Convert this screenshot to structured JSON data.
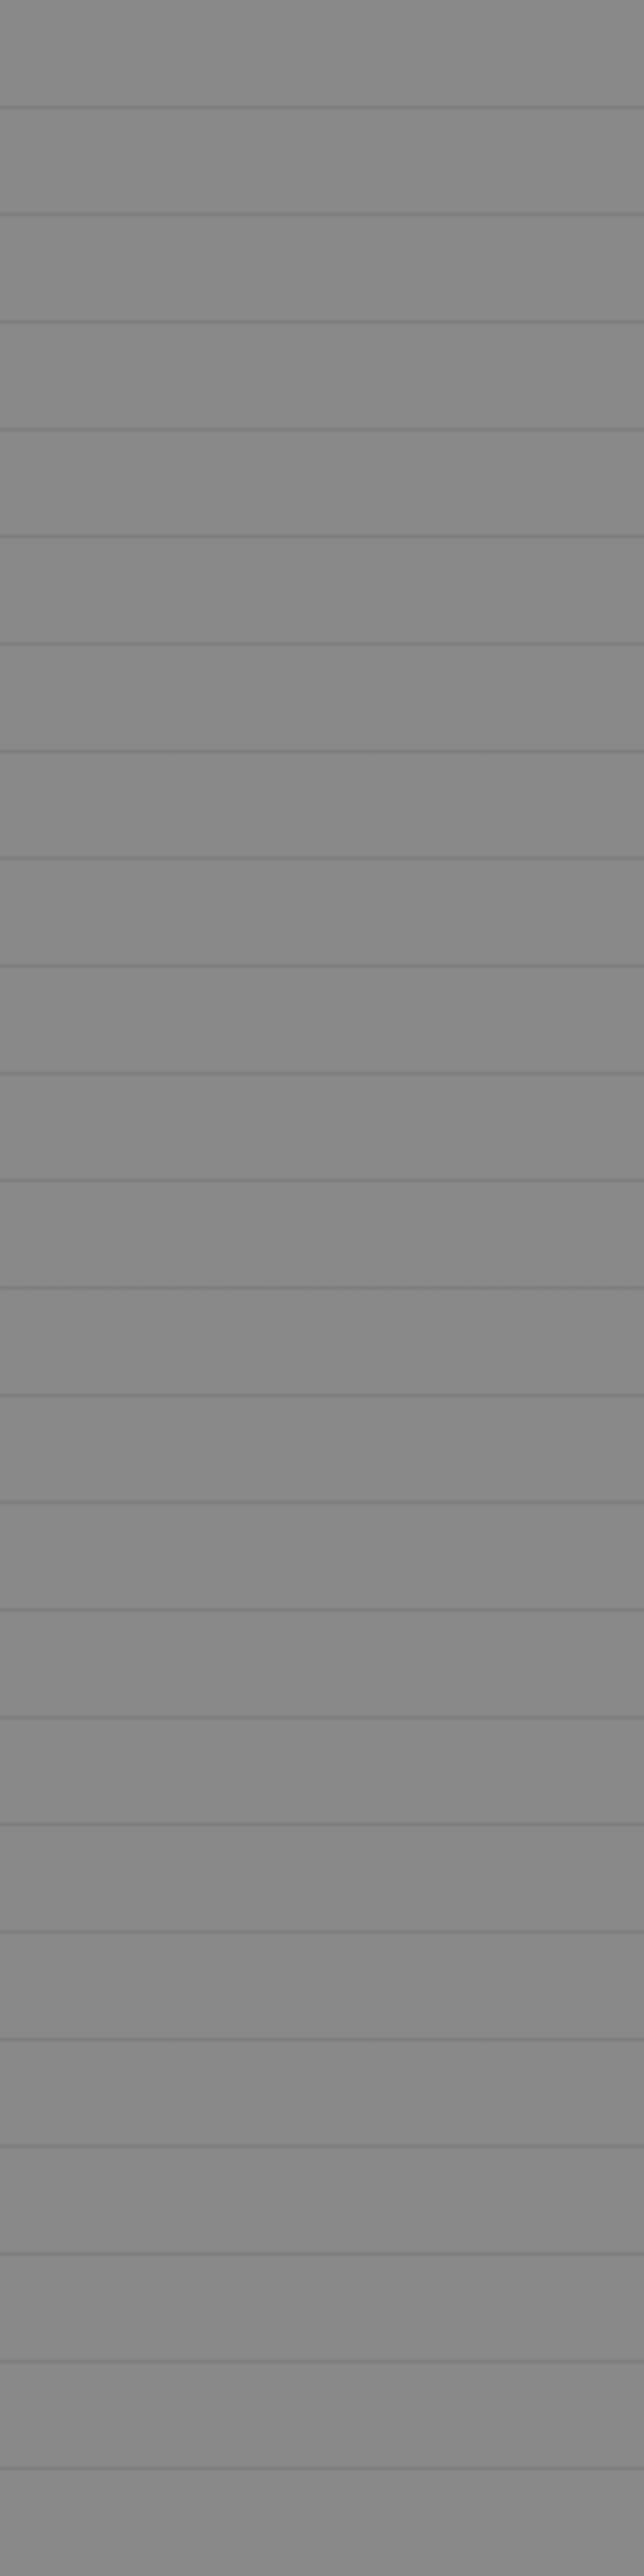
{
  "surface": {
    "base_color": "#898989",
    "seam_color": "#7a7a7a",
    "band_count": 24
  }
}
